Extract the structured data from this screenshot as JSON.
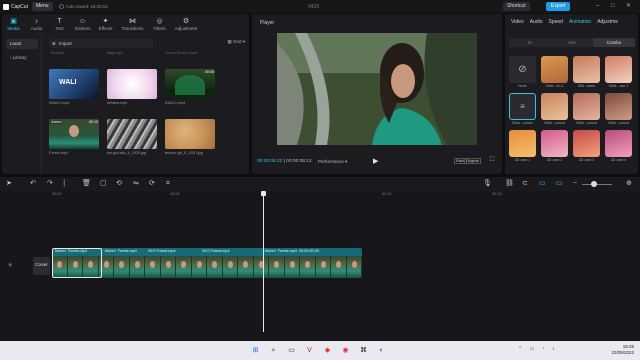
{
  "titlebar": {
    "app_name": "CapCut",
    "menu_label": "Menu",
    "saved_status": "Auto saved: 18:25:02",
    "project_name": "0426",
    "shortcut_label": "Shortcut",
    "export_label": "Export"
  },
  "media": {
    "tabs": [
      {
        "label": "Media",
        "icon": "media-icon"
      },
      {
        "label": "Audio",
        "icon": "audio-icon"
      },
      {
        "label": "Text",
        "icon": "text-icon"
      },
      {
        "label": "Stickers",
        "icon": "stickers-icon"
      },
      {
        "label": "Effects",
        "icon": "effects-icon"
      },
      {
        "label": "Transitions",
        "icon": "transitions-icon"
      },
      {
        "label": "Filters",
        "icon": "filters-icon"
      },
      {
        "label": "Adjustment",
        "icon": "adjustment-icon"
      }
    ],
    "sidebar": [
      "Local",
      "Library"
    ],
    "import_label": "Import",
    "grid_label": "Grid",
    "faded_names": [
      "Beckett",
      "Bajg.mp4",
      "Green Screen.mp4"
    ],
    "thumbs": [
      {
        "label": "0446.0.mp4",
        "badge": "",
        "duration": ""
      },
      {
        "label": "Whites.mp4",
        "badge": "",
        "duration": ""
      },
      {
        "label": "0446.0.mp4",
        "badge": "",
        "duration": "00:05"
      },
      {
        "label": "Forest.mp4",
        "badge": "Added",
        "duration": "00:10"
      },
      {
        "label": "bw-girl-talk_4_1920.jpg",
        "badge": "",
        "duration": ""
      },
      {
        "label": "texture-gfl_5_1920.jpg",
        "badge": "",
        "duration": ""
      }
    ]
  },
  "player": {
    "title": "Player",
    "current_time": "00:00:05:22",
    "total_time": "00:00:08:12",
    "performance_label": "Performance",
    "ratio_label": "Ratio",
    "original_label": "Original"
  },
  "right_panel": {
    "tabs": [
      "Video",
      "Audio",
      "Speed",
      "Animation",
      "Adjustme"
    ],
    "active_tab": "Animation",
    "subtabs": [
      "In",
      "Out",
      "Combo"
    ],
    "active_subtab": "Combo",
    "items": [
      "None",
      "Slide...on 1",
      "Slid...wave",
      "Slide...ave 2",
      "Blow...ounce",
      "Slide...ounce",
      "Slide...ounce",
      "Slide...ounce",
      "3D card 1",
      "3D card 2",
      "3D card 3",
      "3D card 4"
    ]
  },
  "timeline": {
    "ticks": [
      "00:00",
      "00:05",
      "00:10",
      "00:15"
    ],
    "cover_label": "Cover",
    "clip_labels": [
      {
        "muted": "Muted",
        "name": "Forest.mp4",
        "time": ""
      },
      {
        "muted": "Muted",
        "name": "Forest.mp4",
        "time": ""
      },
      {
        "muted": "",
        "name": "Forest.mp4",
        "time": "00:0"
      },
      {
        "muted": "",
        "name": "Forest.mp4",
        "time": "00:0"
      },
      {
        "muted": "Muted",
        "name": "Forest.mp4",
        "time": "00:00:00:20"
      }
    ]
  },
  "taskbar": {
    "time": "18:25",
    "date": "22/09/2022"
  },
  "colors": {
    "accent": "#2fc6e0",
    "export": "#1e9de6",
    "track": "#176b78"
  }
}
